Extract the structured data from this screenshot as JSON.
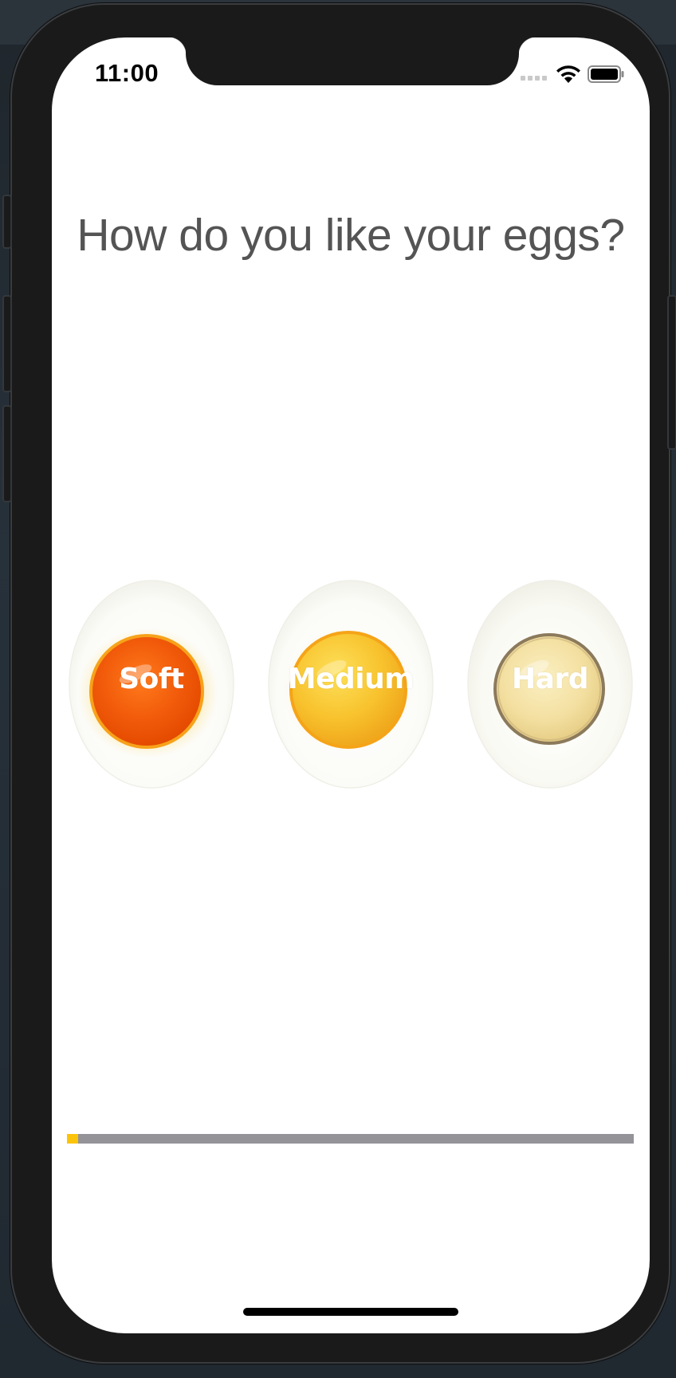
{
  "status_bar": {
    "time": "11:00",
    "icons": [
      "cellular-signal-icon",
      "wifi-icon",
      "battery-icon"
    ]
  },
  "main": {
    "question": "How do you like your eggs?",
    "egg_options": [
      {
        "label": "Soft",
        "icon": "soft-boiled-egg-icon",
        "yolk_color": "#f15a0a"
      },
      {
        "label": "Medium",
        "icon": "medium-boiled-egg-icon",
        "yolk_color": "#f7b52a"
      },
      {
        "label": "Hard",
        "icon": "hard-boiled-egg-icon",
        "yolk_color": "#f3dfa0"
      }
    ]
  },
  "progress": {
    "value": 0.02,
    "fill_color": "#fcc30b",
    "track_color": "#939398"
  },
  "colors": {
    "background": "#ffffff",
    "question_text": "#545454",
    "phone_frame": "#1a1a1a"
  }
}
